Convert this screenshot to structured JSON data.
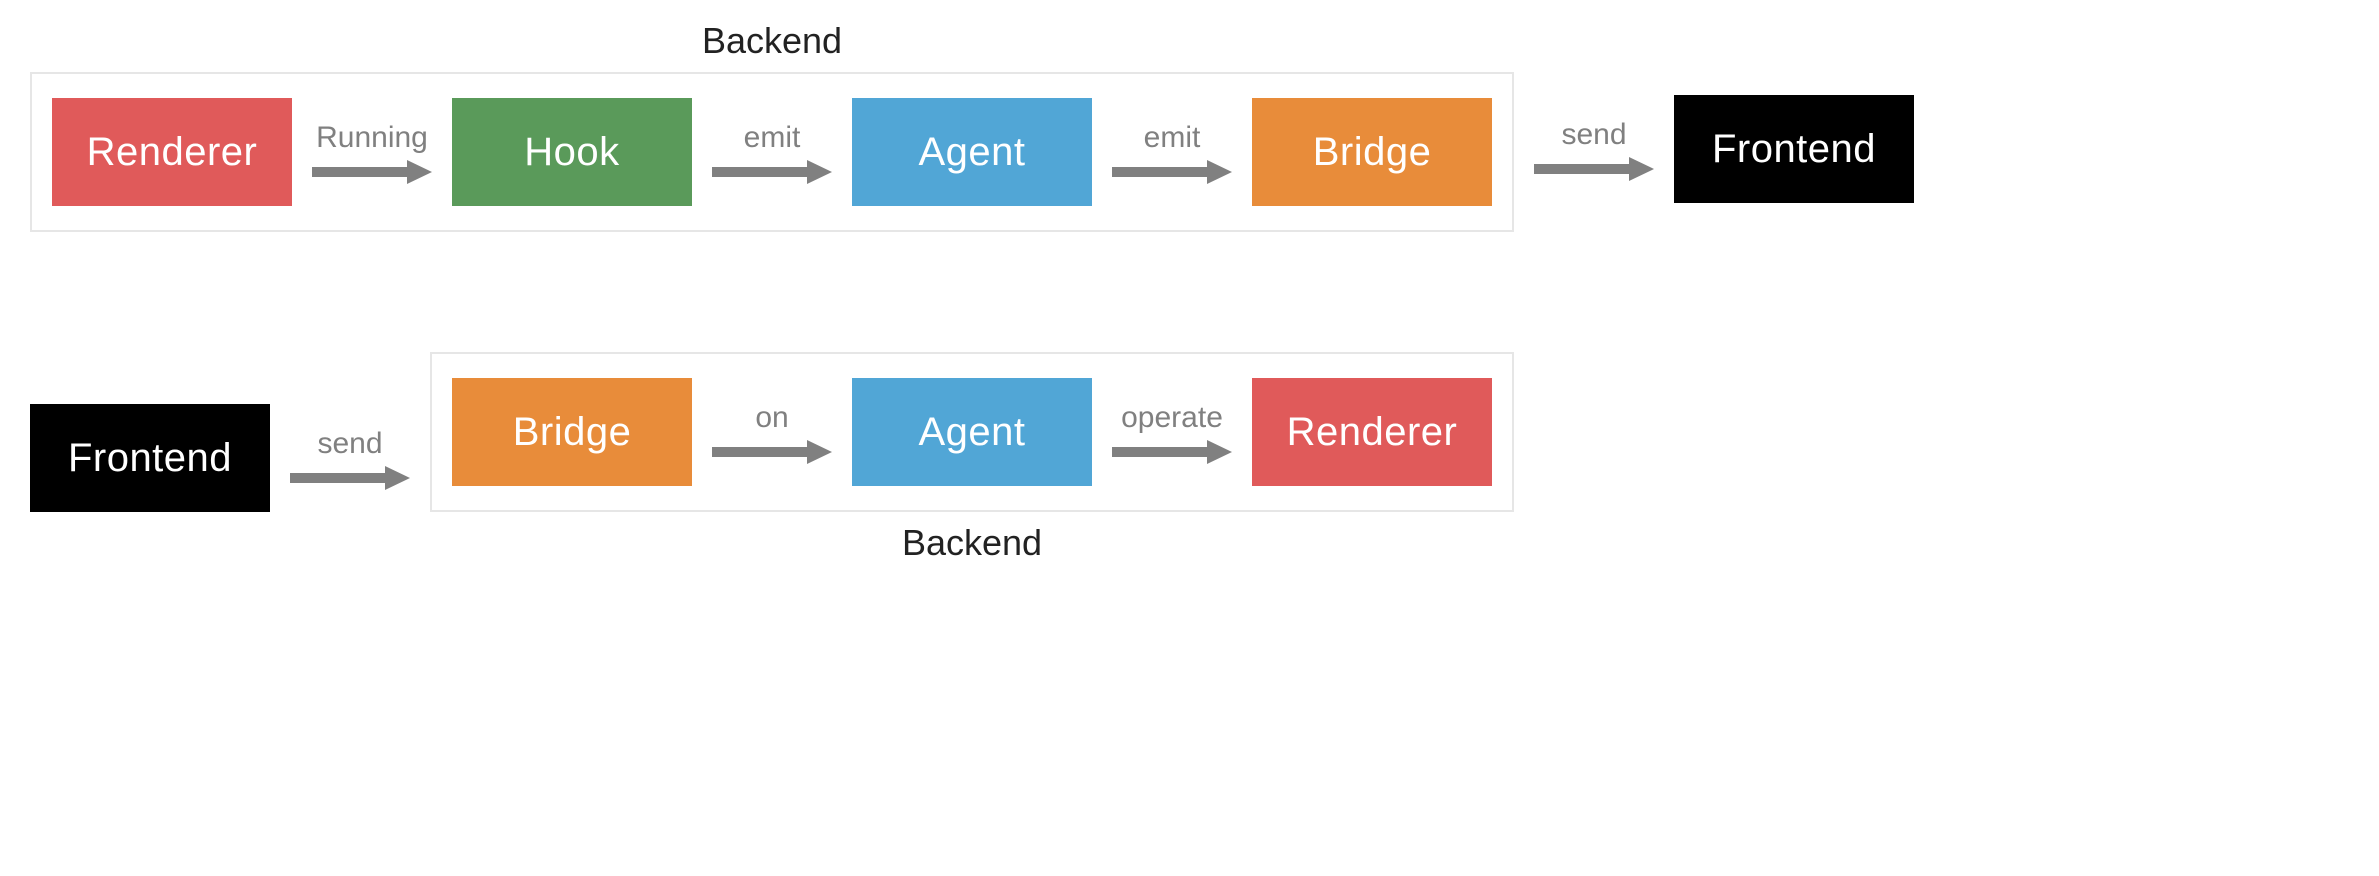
{
  "flows": {
    "top": {
      "group_label": "Backend",
      "nodes": {
        "renderer": "Renderer",
        "hook": "Hook",
        "agent": "Agent",
        "bridge": "Bridge",
        "frontend": "Frontend"
      },
      "arrows": {
        "renderer_hook": "Running",
        "hook_agent": "emit",
        "agent_bridge": "emit",
        "bridge_frontend": "send"
      }
    },
    "bottom": {
      "group_label": "Backend",
      "nodes": {
        "frontend": "Frontend",
        "bridge": "Bridge",
        "agent": "Agent",
        "renderer": "Renderer"
      },
      "arrows": {
        "frontend_bridge": "send",
        "bridge_agent": "on",
        "agent_renderer": "operate"
      }
    }
  }
}
